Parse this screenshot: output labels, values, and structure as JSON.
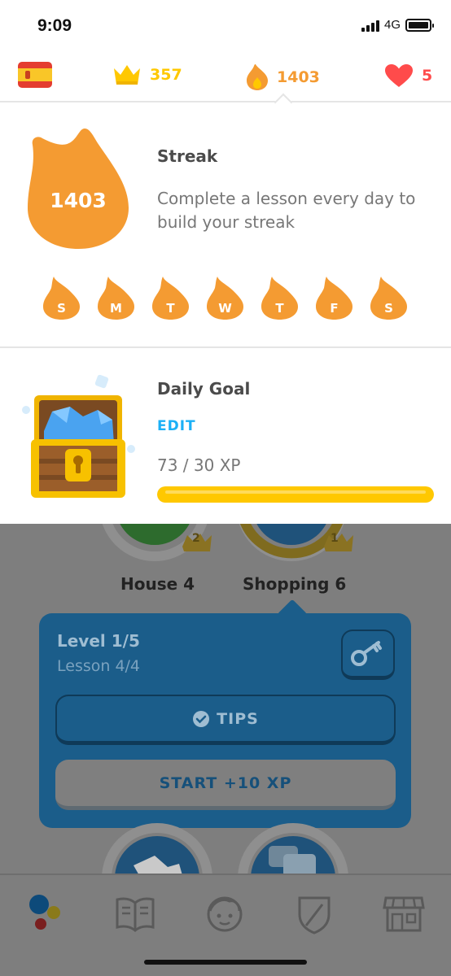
{
  "status_bar": {
    "time": "9:09",
    "network": "4G"
  },
  "header": {
    "crowns": "357",
    "streak": "1403",
    "hearts": "5",
    "colors": {
      "crown": "#ffc800",
      "streak": "#f49b32",
      "heart": "#ff4b4b"
    }
  },
  "streak_panel": {
    "count": "1403",
    "title": "Streak",
    "description": "Complete a lesson every day to build your streak",
    "days": [
      "S",
      "M",
      "T",
      "W",
      "T",
      "F",
      "S"
    ]
  },
  "daily_goal": {
    "title": "Daily Goal",
    "edit_label": "EDIT",
    "xp_text": "73 / 30 XP",
    "progress_fraction": 1.0
  },
  "skills": [
    {
      "name": "House 4",
      "crown_level": "2"
    },
    {
      "name": "Shopping 6",
      "crown_level": "1"
    }
  ],
  "lesson_popup": {
    "level": "Level 1/5",
    "lesson": "Lesson 4/4",
    "tips_label": "TIPS",
    "start_label": "START +10 XP"
  },
  "bottom_nav": {
    "icons": [
      "learn-icon",
      "stories-icon",
      "profile-icon",
      "leaderboard-icon",
      "shop-icon"
    ]
  }
}
